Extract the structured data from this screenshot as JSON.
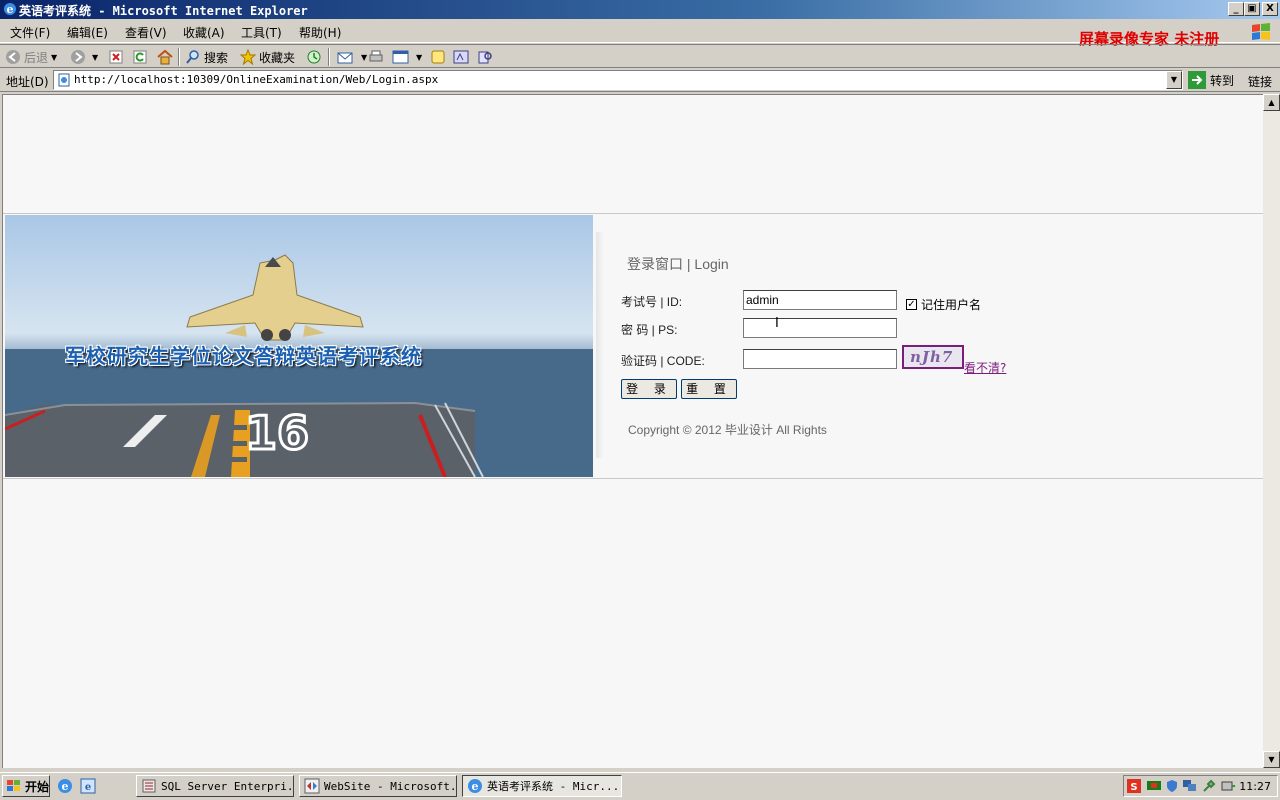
{
  "window": {
    "title": "英语考评系统 - Microsoft Internet Explorer",
    "minimize": "_",
    "maximize": "▣",
    "close": "X"
  },
  "menu": {
    "items": [
      "文件(F)",
      "编辑(E)",
      "查看(V)",
      "收藏(A)",
      "工具(T)",
      "帮助(H)"
    ],
    "watermark": "屏幕录像专家 未注册"
  },
  "toolbar": {
    "back": "后退",
    "search": "搜索",
    "favorites": "收藏夹"
  },
  "address": {
    "label": "地址(D)",
    "url": "http://localhost:10309/OnlineExamination/Web/Login.aspx",
    "go": "转到",
    "links": "链接"
  },
  "banner": {
    "title": "军校研究生学位论文答辩英语考评系统",
    "deck_number": "16"
  },
  "login": {
    "heading": "登录窗口 | Login",
    "id_label": "考试号 | ID:",
    "id_value": "admin",
    "remember_label": "记住用户名",
    "remember_checked": true,
    "password_label": "密 码 | PS:",
    "password_value": "",
    "code_label": "验证码 | CODE:",
    "code_value": "",
    "captcha_text": "nJh7",
    "refresh_link": "看不清?",
    "login_button": "登 录",
    "reset_button": "重 置",
    "copyright": "Copyright © 2012 毕业设计  All Rights"
  },
  "taskbar": {
    "start": "开始",
    "tasks": [
      {
        "label": "SQL Server Enterpri..."
      },
      {
        "label": "WebSite - Microsoft..."
      },
      {
        "label": "英语考评系统 - Micr...",
        "active": true
      }
    ],
    "clock": "11:27"
  },
  "colors": {
    "titlebar": "#0a246a",
    "watermark": "#e00000",
    "captcha_border": "#7b1e7b",
    "banner_title": "#1a5fb0"
  }
}
